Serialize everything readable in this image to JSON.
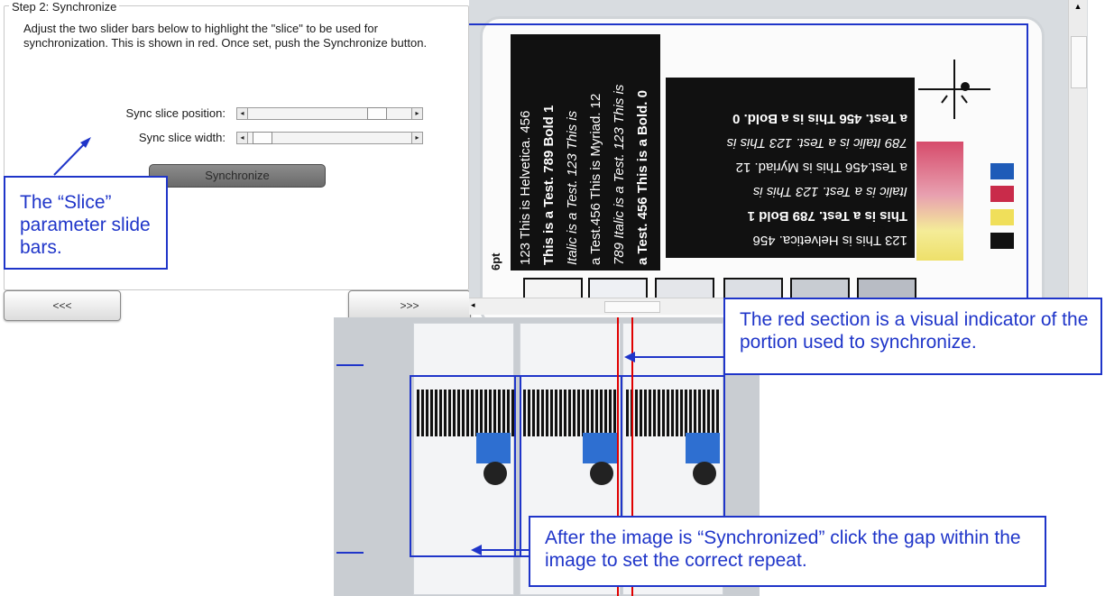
{
  "step": {
    "title": "Step 2: Synchronize",
    "description": "Adjust the two slider bars below to highlight the \"slice\" to be used for synchronization.  This is shown in red.  Once set, push the Synchronize button."
  },
  "sliders": {
    "position_label": "Sync slice position:",
    "width_label": "Sync slice width:",
    "position_value": 0.75,
    "width_value": 0.05
  },
  "buttons": {
    "synchronize": "Synchronize",
    "prev": "<<<",
    "next": ">>>"
  },
  "callouts": {
    "slice": "The “Slice” parameter slide bars.",
    "red_section": "The red section is a visual indicator of the portion used to synchronize.",
    "synchronized": "After the image is “Synchronized” click the gap within the image to set the correct repeat."
  },
  "preview": {
    "vertical_text": [
      "123 This is Helvetica. 456",
      "This is a Test. 789 Bold 1",
      "Italic is a Test. 123 This is",
      "a Test.456 This is Myriad. 12",
      "789 Italic is a Test. 123 This is",
      "a Test. 456 This is a Bold. 0"
    ],
    "size_label": "6pt",
    "colors": {
      "cyan": "#1e5bb8",
      "magenta": "#c92b4a",
      "yellow": "#f0df5a",
      "black": "#111111",
      "highlight": "#1f35c9",
      "red": "#e00000"
    }
  }
}
